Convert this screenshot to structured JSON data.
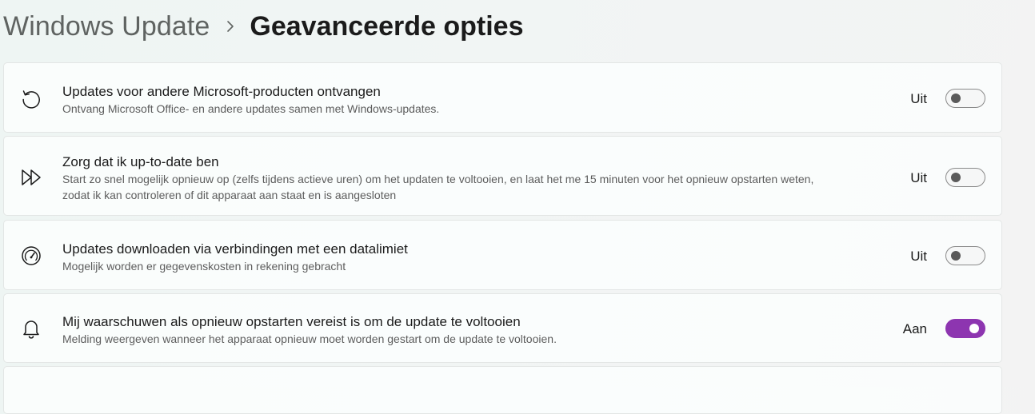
{
  "breadcrumb": {
    "parent": "Windows Update",
    "current": "Geavanceerde opties",
    "separator_icon": "chevron-right-icon"
  },
  "settings": [
    {
      "icon": "refresh-icon",
      "title": "Updates voor andere Microsoft-producten ontvangen",
      "description": "Ontvang Microsoft Office- en andere updates samen met Windows-updates.",
      "state_label": "Uit",
      "toggle_on": false
    },
    {
      "icon": "fast-forward-icon",
      "title": "Zorg dat ik up-to-date ben",
      "description_line1": "Start zo snel mogelijk opnieuw op (zelfs tijdens actieve uren) om het updaten te voltooien, en laat het me 15 minuten voor het opnieuw opstarten weten,",
      "description_line2": "zodat ik kan controleren of dit apparaat aan staat en is aangesloten",
      "state_label": "Uit",
      "toggle_on": false
    },
    {
      "icon": "speedometer-icon",
      "title": "Updates downloaden via verbindingen met een datalimiet",
      "description": "Mogelijk worden er gegevenskosten in rekening gebracht",
      "state_label": "Uit",
      "toggle_on": false
    },
    {
      "icon": "bell-icon",
      "title": "Mij waarschuwen als opnieuw opstarten vereist is om de update te voltooien",
      "description": "Melding weergeven wanneer het apparaat opnieuw moet worden gestart om de update te voltooien.",
      "state_label": "Aan",
      "toggle_on": true
    }
  ],
  "colors": {
    "accent": "#8d35b0",
    "toggle_off_knob": "#5a5a5a"
  }
}
